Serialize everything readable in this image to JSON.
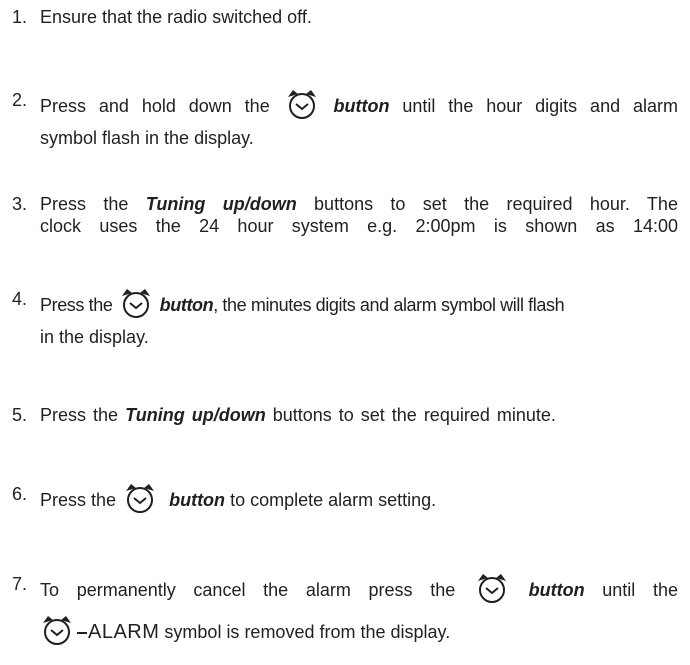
{
  "steps": [
    {
      "num": "1.",
      "text": "Ensure that the radio switched off."
    },
    {
      "num": "2.",
      "line1_before": "Press and hold down the",
      "line1_bold": "button",
      "line1_after": "until the hour digits and alarm",
      "line2": "symbol flash in the display."
    },
    {
      "num": "3.",
      "line1_before": "Press the",
      "line1_bold": "Tuning up/down",
      "line1_after": "buttons to set the required hour. The",
      "line2": "clock uses the 24 hour system e.g. 2:00pm is shown as 14:00"
    },
    {
      "num": "4.",
      "line1_before": "Press the",
      "line1_bold": "button",
      "line1_after": ", the minutes digits and alarm symbol will flash",
      "line2": "in the display."
    },
    {
      "num": "5.",
      "before": "Press the",
      "bold": "Tuning up/down",
      "after": "buttons to set the required minute."
    },
    {
      "num": "6.",
      "before": "Press the",
      "bold": "button",
      "after": "to complete alarm setting."
    },
    {
      "num": "7.",
      "line1_before": "To permanently cancel the alarm press  the",
      "line1_bold": "button",
      "line1_after": "until the",
      "alarm_label": "ALARM",
      "line2_after": "symbol is removed from the display."
    }
  ],
  "icon_name": "alarm-clock-icon",
  "text_color": "#231f20"
}
